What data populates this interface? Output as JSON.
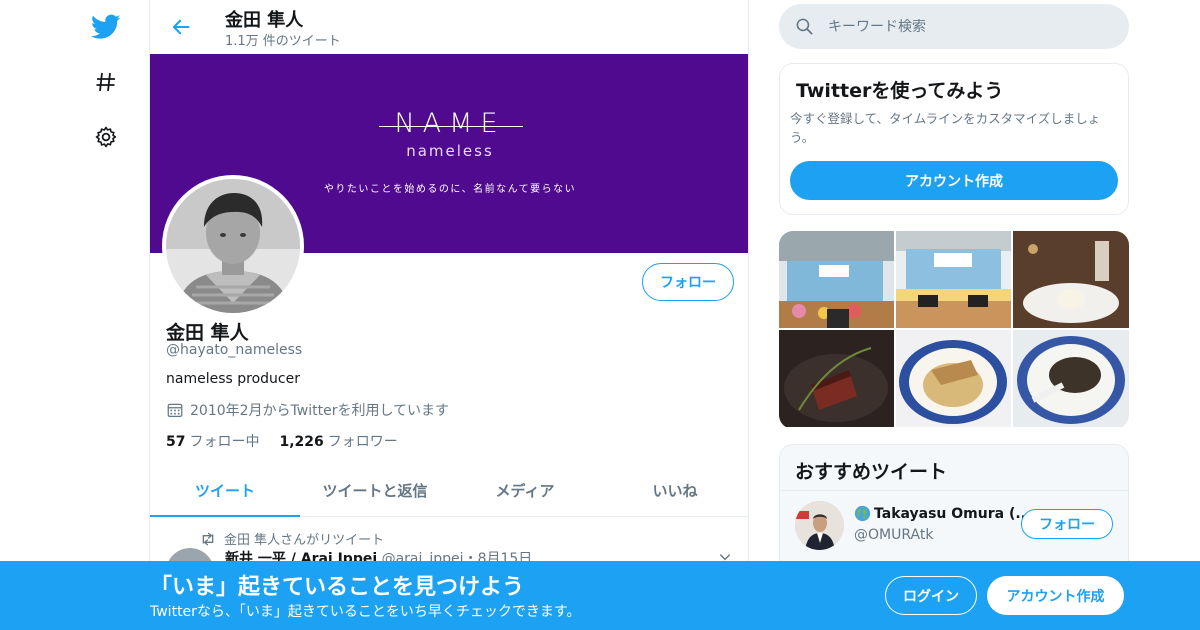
{
  "colors": {
    "accent": "#1da1f2",
    "banner": "#4f0a8f",
    "muted": "#657786"
  },
  "header": {
    "name": "金田 隼人",
    "tweet_count": "1.1万 件のツイート"
  },
  "banner": {
    "logo": "NAME",
    "logo_sub": "nameless",
    "tagline": "やりたいことを始めるのに、名前なんて要らない"
  },
  "profile": {
    "follow_label": "フォロー",
    "name": "金田 隼人",
    "handle": "@hayato_nameless",
    "bio": "nameless producer",
    "joined": "2010年2月からTwitterを利用しています",
    "following_count": "57",
    "following_label": "フォロー中",
    "followers_count": "1,226",
    "followers_label": "フォロワー"
  },
  "tabs": [
    {
      "label": "ツイート",
      "active": true
    },
    {
      "label": "ツイートと返信",
      "active": false
    },
    {
      "label": "メディア",
      "active": false
    },
    {
      "label": "いいね",
      "active": false
    }
  ],
  "tweet": {
    "retweet_note": "金田 隼人さんがリツイート",
    "author_name": "新井 一平 / Arai Ippei",
    "author_handle": "@arai_ippei",
    "date": "・8月15日"
  },
  "search": {
    "placeholder": "キーワード検索"
  },
  "signup_card": {
    "title": "Twitterを使ってみよう",
    "description": "今すぐ登録して、タイムラインをカスタマイズしましょう。",
    "button": "アカウント作成"
  },
  "media_icons": [
    "event-stage-photo",
    "event-stage-photo",
    "dessert-photo",
    "steak-photo",
    "pasta-photo",
    "dish-photo"
  ],
  "recommended": {
    "title": "おすすめツイート",
    "user_name": "Takayasu Omura (...",
    "user_handle": "@OMURAtk",
    "follow_label": "フォロー"
  },
  "bottom_bar": {
    "title": "「いま」起きていることを見つけよう",
    "subtitle": "Twitterなら、「いま」起きていることをいち早くチェックできます。",
    "login": "ログイン",
    "signup": "アカウント作成"
  },
  "rail_icons": [
    "twitter-bird-icon",
    "hashtag-icon",
    "gear-icon"
  ]
}
